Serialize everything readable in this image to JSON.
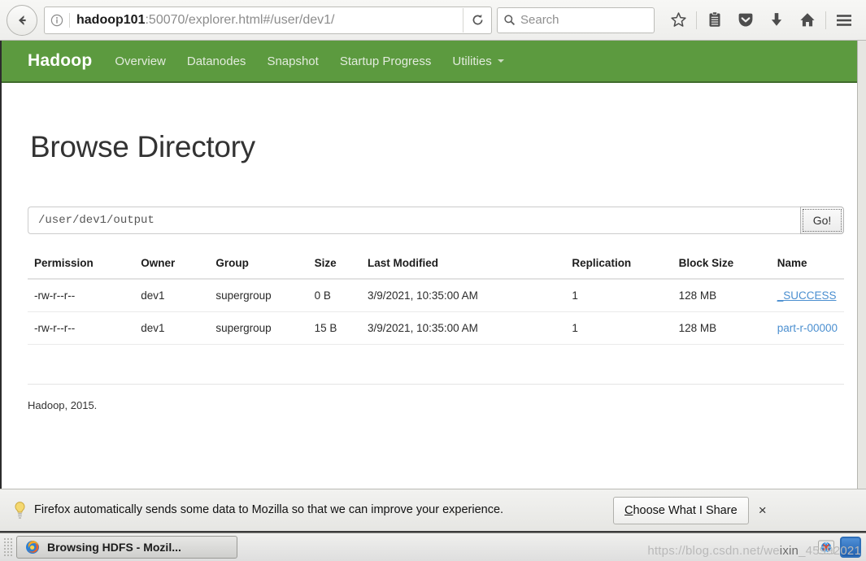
{
  "browser": {
    "back_label": "Back",
    "identity_icon": "info-circle-icon",
    "url_host": "hadoop101",
    "url_rest": ":50070/explorer.html#/user/dev1/",
    "reload_icon": "reload-icon",
    "search_placeholder": "Search",
    "search_value": "",
    "toolbar_icons": [
      {
        "name": "bookmark-star-icon",
        "label": "Bookmark this page"
      },
      {
        "name": "reader-list-icon",
        "label": "Show your library"
      },
      {
        "name": "pocket-icon",
        "label": "Save to Pocket"
      },
      {
        "name": "downloads-icon",
        "label": "Downloads"
      },
      {
        "name": "home-icon",
        "label": "Home"
      },
      {
        "name": "menu-hamburger-icon",
        "label": "Open menu"
      }
    ]
  },
  "hadoop_nav": {
    "brand": "Hadoop",
    "links": [
      {
        "label": "Overview"
      },
      {
        "label": "Datanodes"
      },
      {
        "label": "Snapshot"
      },
      {
        "label": "Startup Progress"
      },
      {
        "label": "Utilities",
        "caret": true
      }
    ]
  },
  "page": {
    "title": "Browse Directory",
    "path_value": "/user/dev1/output",
    "path_placeholder": "/user/dev1/output",
    "go_label": "Go!",
    "footer": "Hadoop, 2015."
  },
  "table": {
    "headers": [
      "Permission",
      "Owner",
      "Group",
      "Size",
      "Last Modified",
      "Replication",
      "Block Size",
      "Name"
    ],
    "rows": [
      {
        "permission": "-rw-r--r--",
        "owner": "dev1",
        "group": "supergroup",
        "size": "0 B",
        "last_modified": "3/9/2021, 10:35:00 AM",
        "replication": "1",
        "block_size": "128 MB",
        "name": "_SUCCESS"
      },
      {
        "permission": "-rw-r--r--",
        "owner": "dev1",
        "group": "supergroup",
        "size": "15 B",
        "last_modified": "3/9/2021, 10:35:00 AM",
        "replication": "1",
        "block_size": "128 MB",
        "name": "part-r-00000"
      }
    ]
  },
  "notification": {
    "icon": "lightbulb-icon",
    "message": "Firefox automatically sends some data to Mozilla so that we can improve your experience.",
    "button_accesskey": "C",
    "button_label_rest": "hoose What I Share",
    "close_label": "×"
  },
  "taskbar": {
    "window_title": "Browsing HDFS - Mozil...",
    "window_icon": "firefox-icon",
    "tray_icons": [
      {
        "name": "network-globe-tray-icon"
      },
      {
        "name": "blue-app-tray-icon"
      }
    ]
  },
  "watermark": {
    "prefix": "https://blog.csdn.net/we",
    "highlight": "ixin",
    "suffix": "_45992021"
  },
  "colors": {
    "hadoop_green": "#5c9a3f",
    "hadoop_green_border": "#3f6b2b",
    "link_blue": "#4b8fd0"
  }
}
